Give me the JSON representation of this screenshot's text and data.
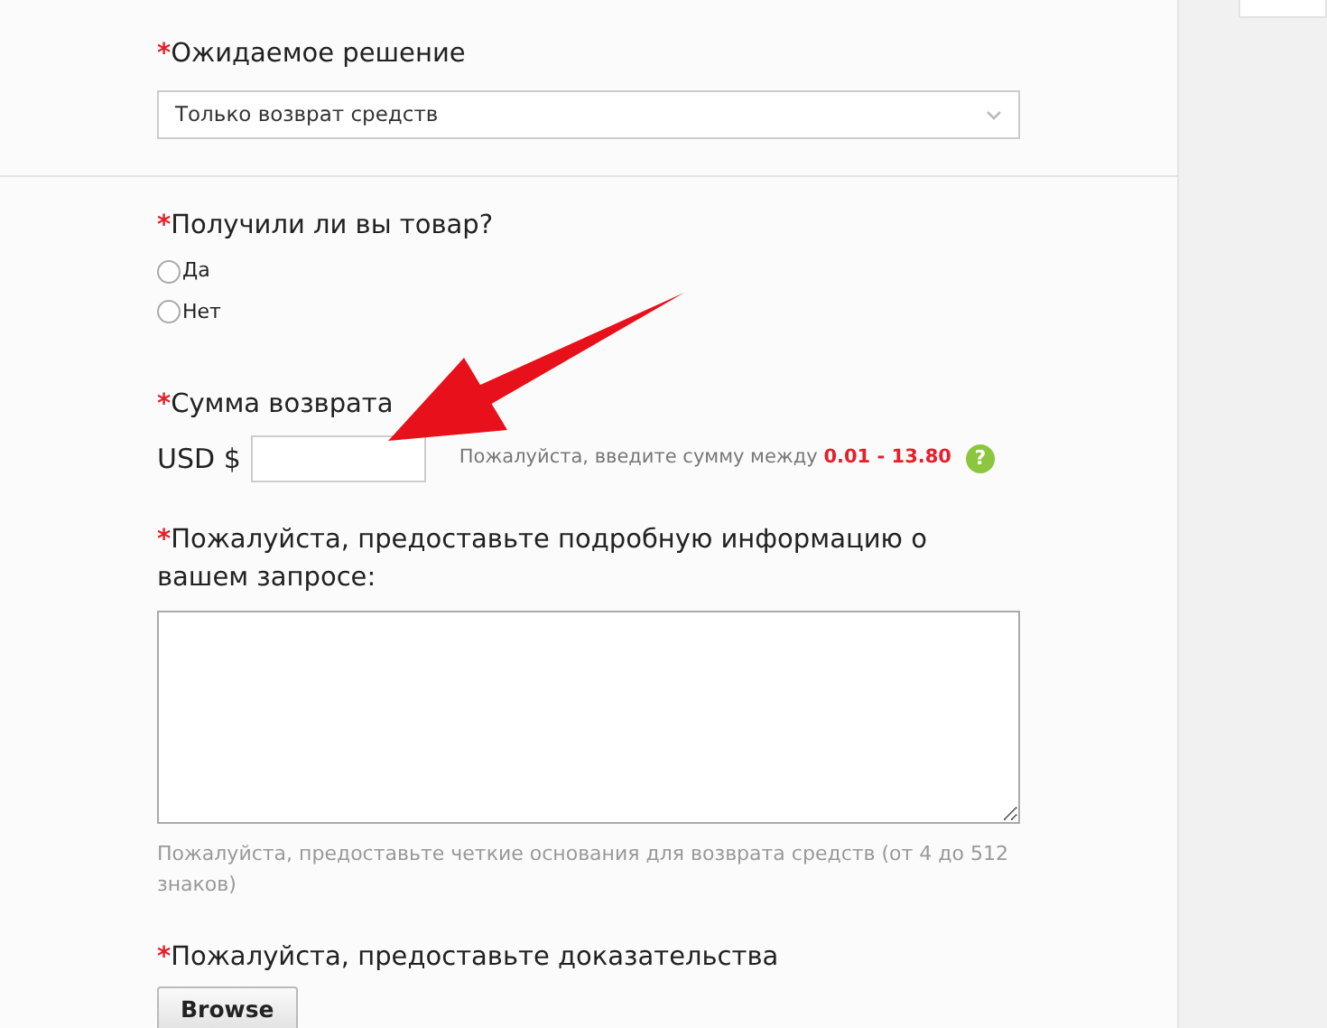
{
  "sections": [
    {
      "kind": "select",
      "mark": "*",
      "label": "Ожидаемое решение",
      "value": "Только возврат средств",
      "divider_after": true
    },
    {
      "kind": "radio",
      "mark": "*",
      "label": "Получили ли вы товар?",
      "options": [
        {
          "label": "Да",
          "selected": false
        },
        {
          "label": "Нет",
          "selected": false
        }
      ]
    },
    {
      "kind": "amount",
      "mark": "*",
      "label": "Сумма возврата",
      "currency": "USD $",
      "hint": "Пожалуйста, введите сумму между",
      "range": "0.01 - 13.80",
      "help": "?"
    },
    {
      "kind": "textarea",
      "mark": "*",
      "label": "Пожалуйста, предоставьте подробную информацию о вашем запросе:",
      "hint": "Пожалуйста, предоставьте четкие основания для возврата средств (от 4 до 512 знаков)"
    },
    {
      "kind": "file",
      "mark": "*",
      "label": "Пожалуйста, предоставьте доказательства",
      "button": "Browse"
    }
  ],
  "annotation": {
    "kind": "arrow"
  }
}
